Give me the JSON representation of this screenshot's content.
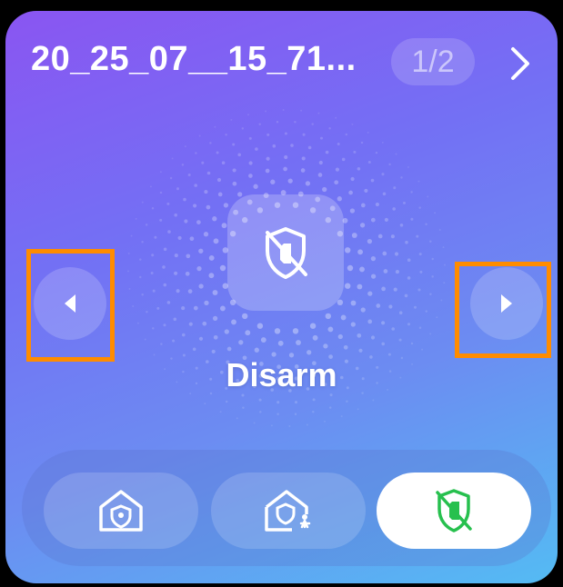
{
  "device": {
    "name": "20_25_07__15_71...",
    "page_indicator": "1/2"
  },
  "current_mode": {
    "label": "Disarm",
    "icon": "shield-disarm-icon"
  },
  "mode_buttons": [
    {
      "icon": "home-arm-icon",
      "active": false
    },
    {
      "icon": "home-stay-icon",
      "active": false
    },
    {
      "icon": "shield-disarm-icon",
      "active": true
    }
  ],
  "colors": {
    "gradient_start": "#8a55f2",
    "gradient_end": "#54bbf3",
    "highlight": "#ff8c00",
    "active_icon": "#27c04e"
  }
}
